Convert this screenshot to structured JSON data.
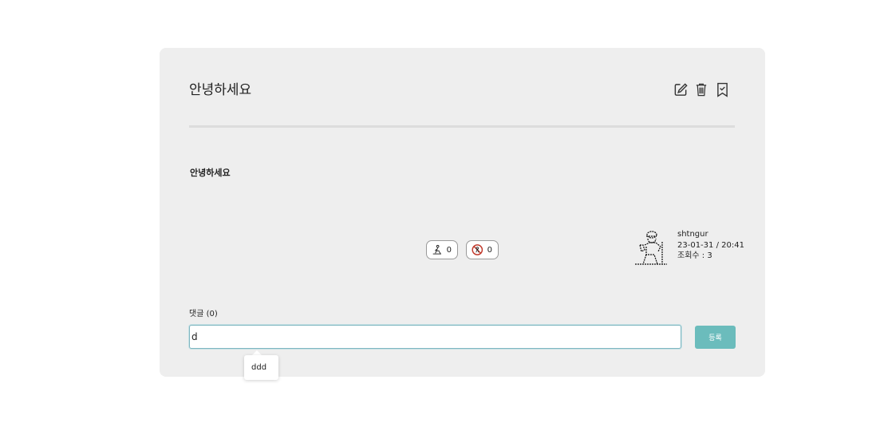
{
  "post": {
    "title": "안녕하세요",
    "content": "안녕하세요"
  },
  "actions": {
    "edit_icon": "edit-icon",
    "delete_icon": "trash-icon",
    "bookmark_icon": "bookmark-icon"
  },
  "votes": {
    "like_count": "0",
    "dislike_count": "0"
  },
  "author": {
    "name": "shtngur",
    "datetime": "23-01-31 / 20:41",
    "views": "조회수 : 3"
  },
  "comments": {
    "label": "댓글 (0)",
    "input_value": "d",
    "submit_label": "등록",
    "suggestion": "ddd"
  },
  "colors": {
    "card_bg": "#eeeeee",
    "accent": "#6bbcbc"
  }
}
